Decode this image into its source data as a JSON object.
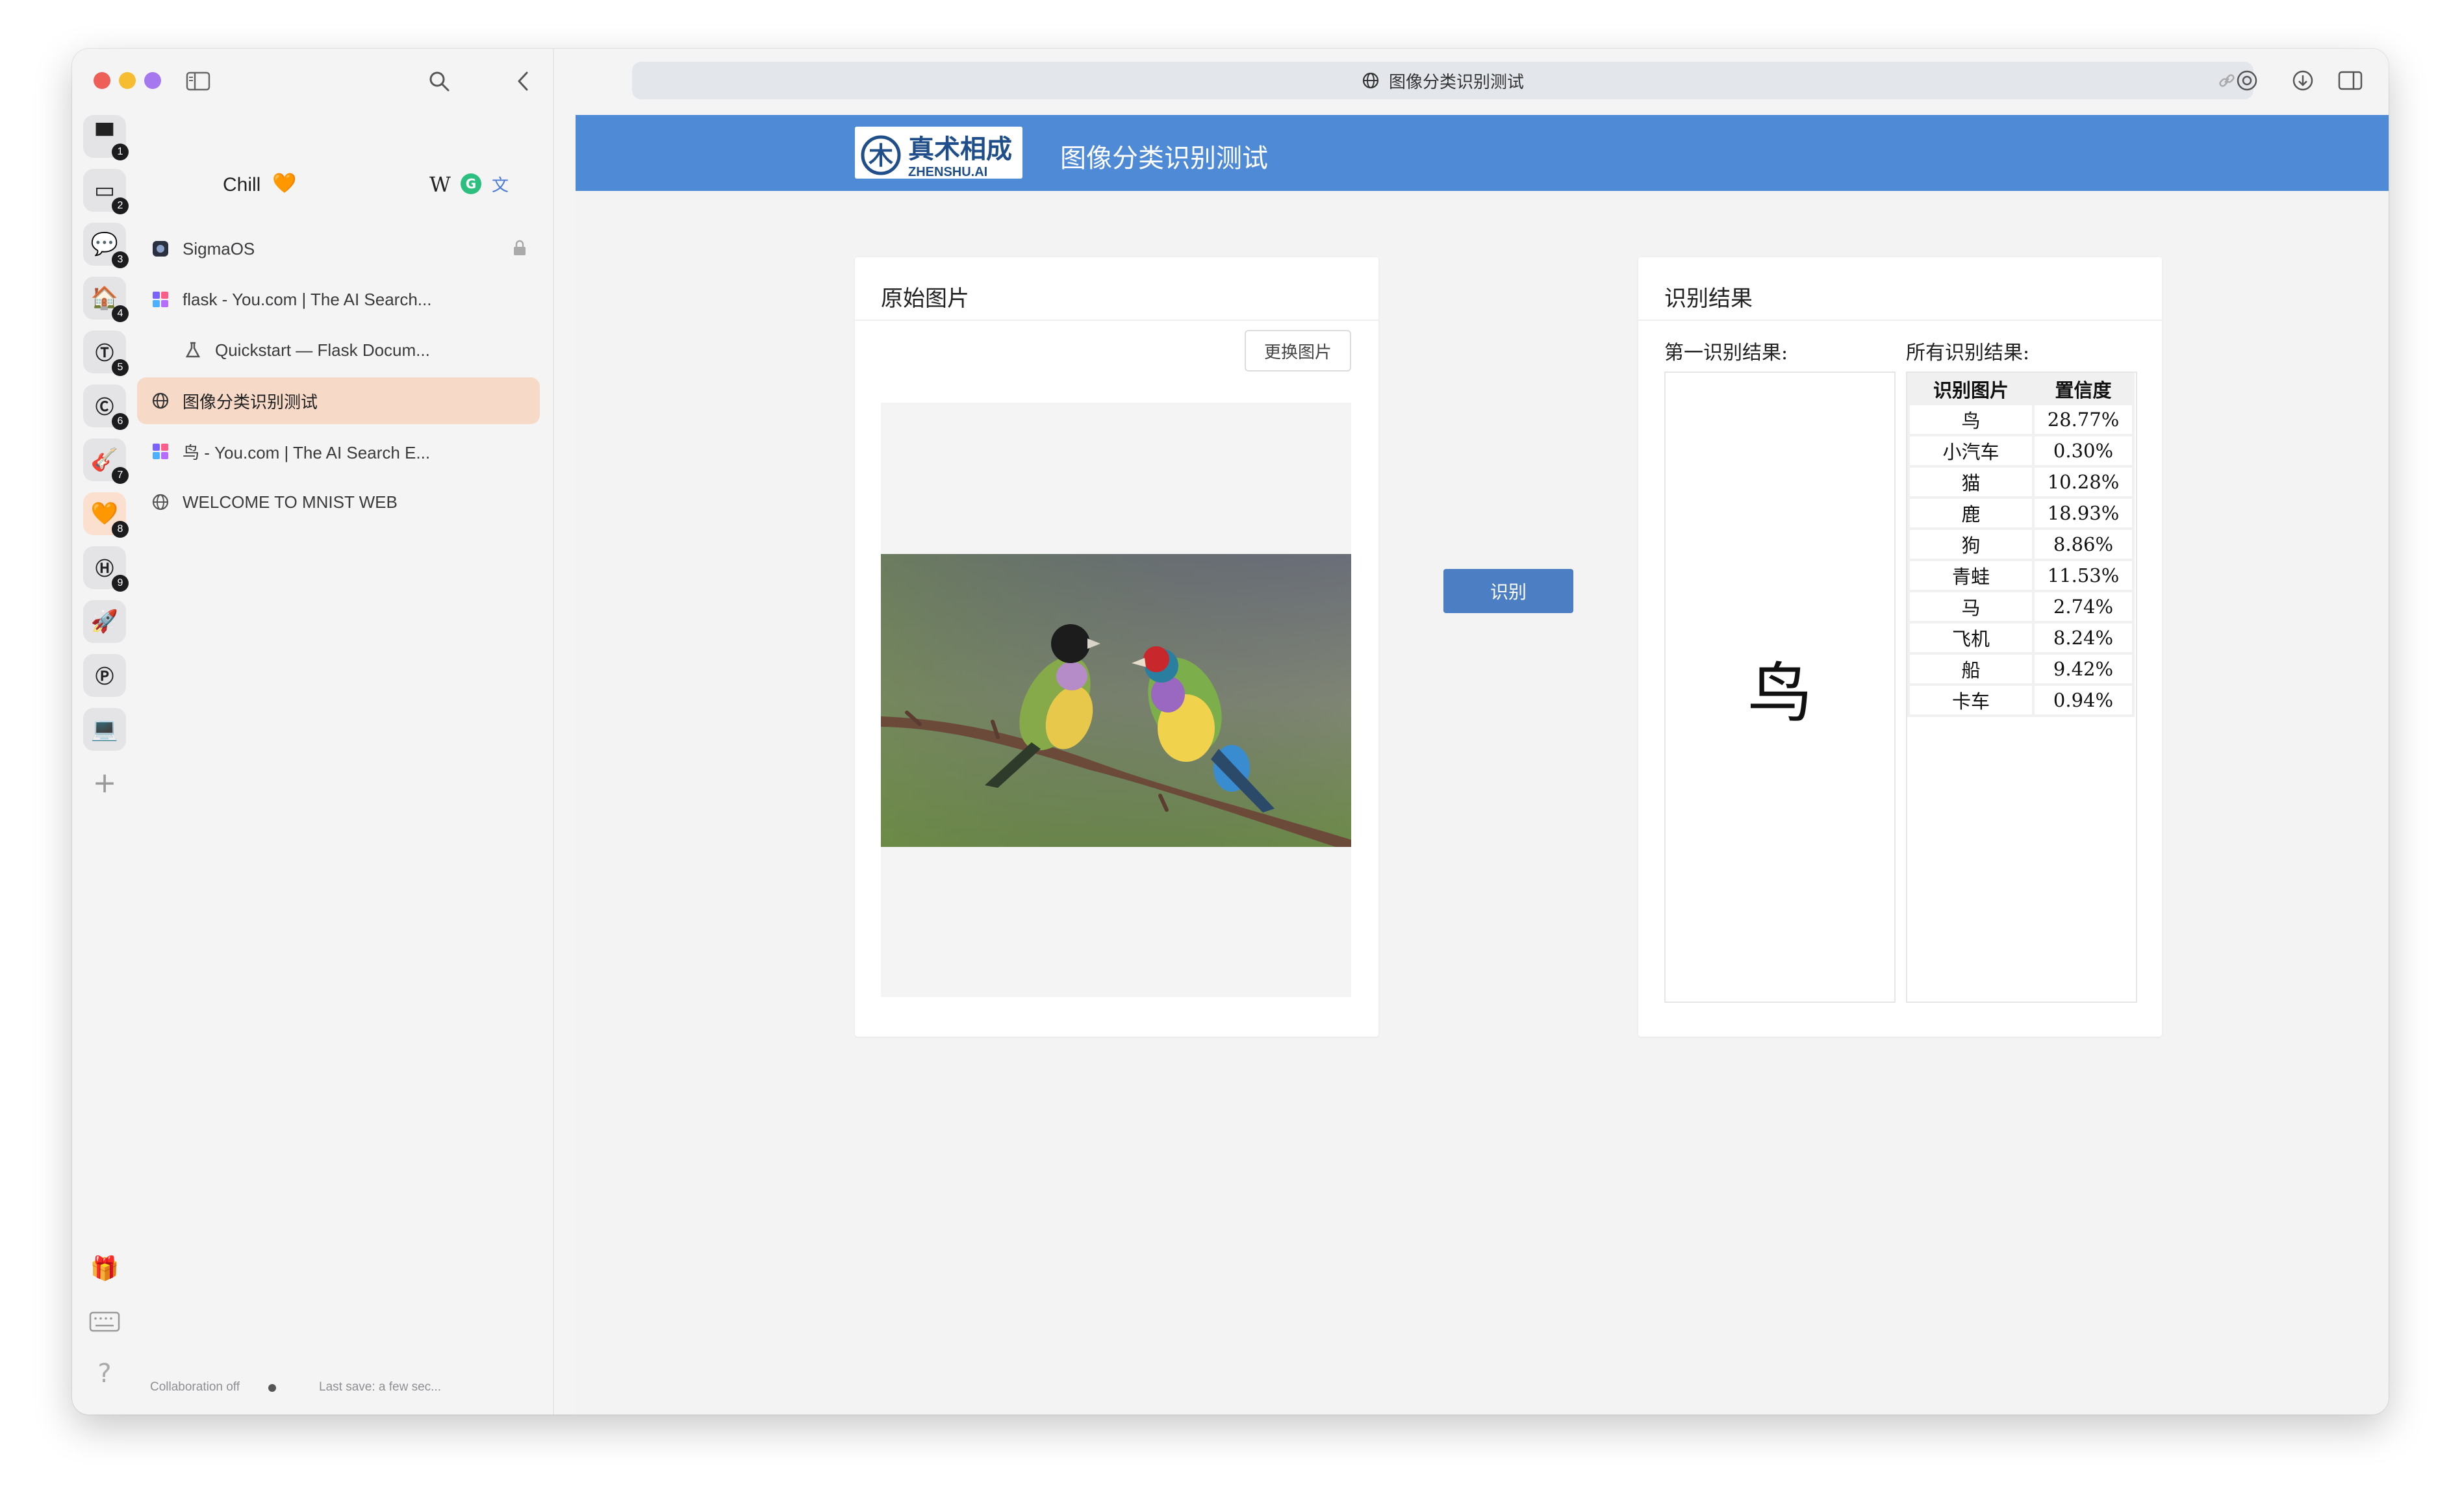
{
  "window": {
    "workspace_title": "Chill",
    "workspace_icons": [
      "W",
      "G",
      "translate-icon"
    ],
    "rail_badges": [
      "1",
      "2",
      "3",
      "4",
      "5",
      "6",
      "7",
      "8",
      "9"
    ],
    "tabs": [
      {
        "label": "SigmaOS",
        "icon": "sigmaos-icon",
        "locked": true
      },
      {
        "label": "flask - You.com | The AI Search...",
        "icon": "you-icon"
      },
      {
        "label": "Quickstart — Flask Docum...",
        "icon": "flask-icon"
      },
      {
        "label": "图像分类识别测试",
        "icon": "globe-icon",
        "active": true
      },
      {
        "label": "鸟 - You.com | The AI Search E...",
        "icon": "you-icon"
      },
      {
        "label": "WELCOME TO MNIST WEB",
        "icon": "globe-icon"
      }
    ],
    "footer": {
      "collaboration": "Collaboration off",
      "last_save": "Last save: a few sec..."
    }
  },
  "toolbar": {
    "url_title": "图像分类识别测试"
  },
  "page": {
    "logo_text": "真术相成",
    "logo_sub": "ZHENSHU.AI",
    "header_title": "图像分类识别测试",
    "original_card_title": "原始图片",
    "change_image_button": "更换图片",
    "recognize_button": "识别",
    "result_card_title": "识别结果",
    "first_result_label": "第一识别结果:",
    "all_results_label": "所有识别结果:",
    "first_result_value": "鸟",
    "table_headers": [
      "识别图片",
      "置信度"
    ],
    "results": [
      {
        "label": "鸟",
        "confidence": "28.77%"
      },
      {
        "label": "小汽车",
        "confidence": "0.30%"
      },
      {
        "label": "猫",
        "confidence": "10.28%"
      },
      {
        "label": "鹿",
        "confidence": "18.93%"
      },
      {
        "label": "狗",
        "confidence": "8.86%"
      },
      {
        "label": "青蛙",
        "confidence": "11.53%"
      },
      {
        "label": "马",
        "confidence": "2.74%"
      },
      {
        "label": "飞机",
        "confidence": "8.24%"
      },
      {
        "label": "船",
        "confidence": "9.42%"
      },
      {
        "label": "卡车",
        "confidence": "0.94%"
      }
    ]
  },
  "colors": {
    "header_blue": "#4e8ad6",
    "button_blue": "#4b7ec2",
    "active_tab": "#f6d9c7"
  }
}
